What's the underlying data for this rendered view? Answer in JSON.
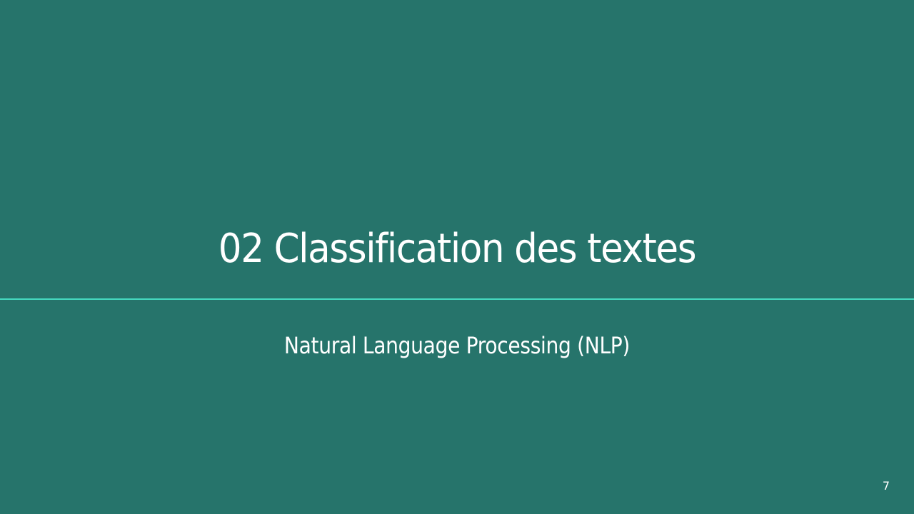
{
  "slide": {
    "title": "02 Classification des textes",
    "subtitle": "Natural Language Processing (NLP)",
    "page_number": "7"
  },
  "colors": {
    "background": "#26746b",
    "divider": "#45d9c0",
    "text": "#ffffff"
  }
}
